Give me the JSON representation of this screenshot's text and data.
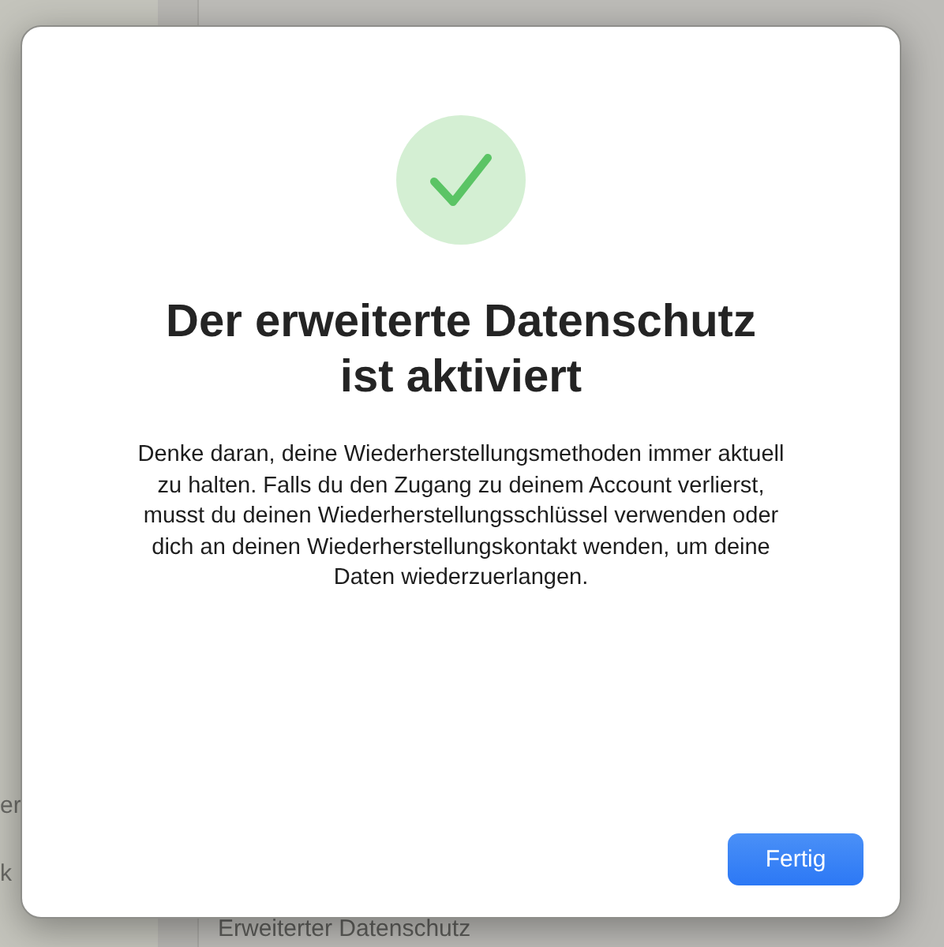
{
  "background": {
    "sidebar_fragments": [
      "er",
      "k"
    ],
    "list_items": [
      "Erweiterter Datenschutz"
    ]
  },
  "dialog": {
    "title": "Der erweiterte Datenschutz ist aktiviert",
    "message": "Denke daran, deine Wiederherstellungsmethoden immer aktuell zu halten. Falls du den Zugang zu deinem Account verlierst, musst du deinen Wiederherstellungsschlüssel verwenden oder dich an deinen Wiederherstellungskontakt wenden, um deine Daten wiederzuerlangen.",
    "buttons": [
      {
        "label": "Fertig",
        "kind": "primary"
      }
    ]
  }
}
